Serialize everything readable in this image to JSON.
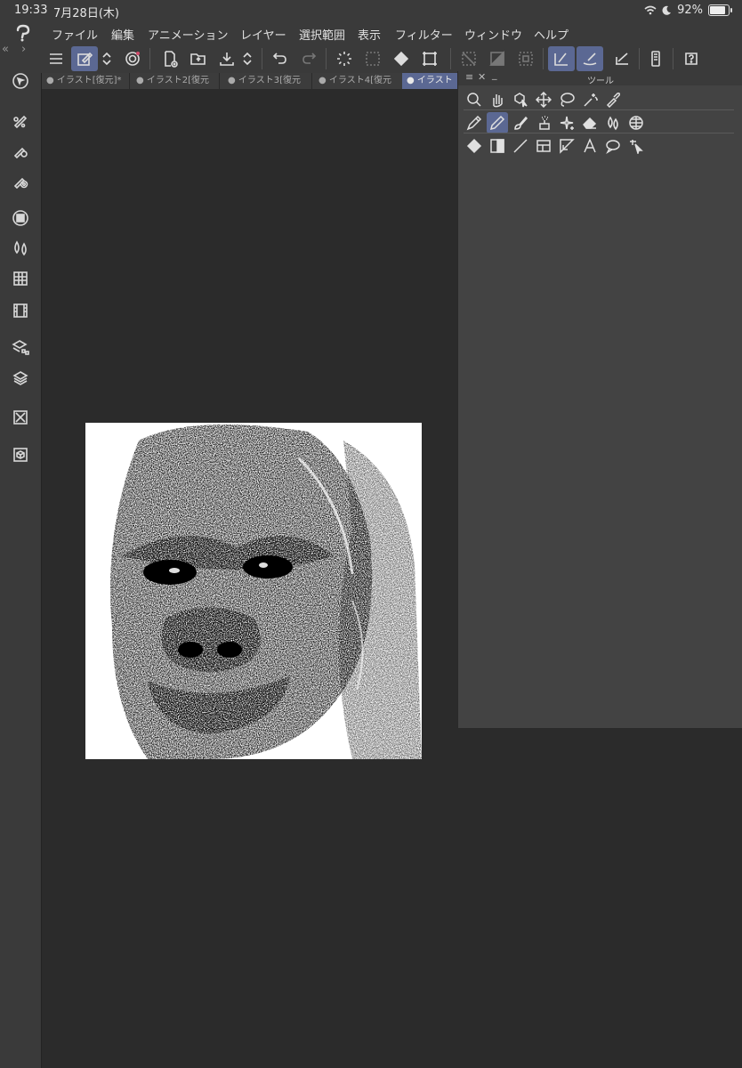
{
  "status_bar": {
    "time": "19:33",
    "date": "7月28日(木)",
    "battery": "92%",
    "battery_level": 0.92
  },
  "menu": [
    "ファイル",
    "編集",
    "アニメーション",
    "レイヤー",
    "選択範囲",
    "表示",
    "フィルター",
    "ウィンドウ",
    "ヘルプ"
  ],
  "tabs": [
    "● イラスト[復元]*",
    "● イラスト2[復元",
    "● イラスト3[復元",
    "● イラスト4[復元",
    "● イラスト"
  ],
  "active_tab_index": 4,
  "tool_palette": {
    "title": "ツール"
  },
  "colors": {
    "accent": "#5b6893",
    "panel": "#434343",
    "bar": "#3a3a3a",
    "canvas_bg": "#2b2b2b"
  }
}
